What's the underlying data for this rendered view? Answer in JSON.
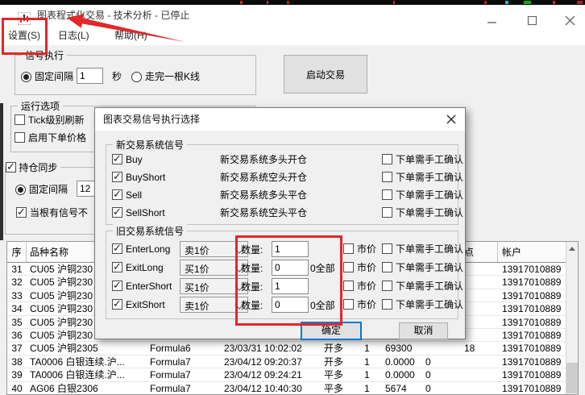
{
  "colors": {
    "annotation_red": "#e0282a",
    "focus_blue": "#0078d7",
    "window_bg": "#f0f0f0",
    "titlebar_bg": "#ffffff"
  },
  "window": {
    "title": "图表程式化交易 - 技术分析 - 已停止",
    "menu": [
      {
        "label": "设置(S)"
      },
      {
        "label": "日志(L)"
      },
      {
        "label": "帮助(H)"
      }
    ]
  },
  "main": {
    "signal_exec": {
      "title": "信号执行",
      "fixed_interval": "固定间隔",
      "interval_value": "1",
      "seconds": "秒",
      "bar_option": "走完一根K线",
      "start_button": "启动交易"
    },
    "run_options": {
      "title": "运行选项",
      "tick": "Tick级别刷新",
      "price": "启用下单价格"
    },
    "pos_sync": {
      "title": "持仓同步",
      "fixed_interval": "固定间隔",
      "interval_value": "12",
      "signal_option": "当根有信号不"
    }
  },
  "dialog": {
    "title": "图表交易信号执行选择",
    "new_group": {
      "title": "新交易系统信号",
      "rows": [
        {
          "name": "Buy",
          "desc": "新交易系统多头开仓",
          "confirm": "下单需手工确认",
          "checked": true,
          "confirm_checked": false
        },
        {
          "name": "BuyShort",
          "desc": "新交易系统空头开仓",
          "confirm": "下单需手工确认",
          "checked": true,
          "confirm_checked": false
        },
        {
          "name": "Sell",
          "desc": "新交易系统多头平仓",
          "confirm": "下单需手工确认",
          "checked": true,
          "confirm_checked": false
        },
        {
          "name": "SellShort",
          "desc": "新交易系统空头平仓",
          "confirm": "下单需手工确认",
          "checked": true,
          "confirm_checked": false
        }
      ]
    },
    "old_group": {
      "title": "旧交易系统信号",
      "qty_label": "数量:",
      "rows": [
        {
          "name": "EnterLong",
          "price_type": "卖1价",
          "qty": "1",
          "all": "",
          "market": "市价",
          "confirm": "下单需手工确认",
          "checked": true,
          "market_checked": false,
          "confirm_checked": false
        },
        {
          "name": "ExitLong",
          "price_type": "买1价",
          "qty": "0",
          "all": "0全部",
          "market": "市价",
          "confirm": "下单需手工确认",
          "checked": true,
          "market_checked": false,
          "confirm_checked": false
        },
        {
          "name": "EnterShort",
          "price_type": "买1价",
          "qty": "1",
          "all": "",
          "market": "市价",
          "confirm": "下单需手工确认",
          "checked": true,
          "market_checked": false,
          "confirm_checked": false
        },
        {
          "name": "ExitShort",
          "price_type": "卖1价",
          "qty": "0",
          "all": "0全部",
          "market": "市价",
          "confirm": "下单需手工确认",
          "checked": true,
          "market_checked": false,
          "confirm_checked": false
        }
      ]
    },
    "ok": "确定",
    "cancel": "取消"
  },
  "table": {
    "headers": {
      "seq": "序",
      "name": "品种名称",
      "formula": "",
      "time": "",
      "dir": "",
      "qty": "",
      "price": "",
      "extra": "",
      "slip": "点",
      "acct": "帐户"
    },
    "rows": [
      {
        "seq": "31",
        "name": "CU05 沪铜230",
        "formula": "",
        "time": "",
        "dir": "",
        "qty": "",
        "price": "",
        "extra": "",
        "slip": "",
        "acct": "13917010889"
      },
      {
        "seq": "32",
        "name": "CU05 沪铜230",
        "formula": "",
        "time": "",
        "dir": "",
        "qty": "",
        "price": "",
        "extra": "",
        "slip": "",
        "acct": "13917010889"
      },
      {
        "seq": "33",
        "name": "CU05 沪铜230",
        "formula": "",
        "time": "",
        "dir": "",
        "qty": "",
        "price": "",
        "extra": "",
        "slip": "",
        "acct": "13917010889"
      },
      {
        "seq": "34",
        "name": "CU05 沪铜230",
        "formula": "",
        "time": "",
        "dir": "",
        "qty": "",
        "price": "",
        "extra": "",
        "slip": "",
        "acct": "13917010889"
      },
      {
        "seq": "35",
        "name": "CU05 沪铜230",
        "formula": "",
        "time": "",
        "dir": "",
        "qty": "",
        "price": "",
        "extra": "",
        "slip": "",
        "acct": "13917010889"
      },
      {
        "seq": "36",
        "name": "CU05 沪铜230",
        "formula": "",
        "time": "",
        "dir": "",
        "qty": "",
        "price": "",
        "extra": "",
        "slip": "",
        "acct": "13917010889"
      },
      {
        "seq": "37",
        "name": "CU05 沪铜2305",
        "formula": "Formula6",
        "time": "23/03/31 10:02:02",
        "dir": "开多",
        "qty": "1",
        "price": "69300",
        "extra": "",
        "slip": "18",
        "acct": "13917010889"
      },
      {
        "seq": "38",
        "name": "TA0006 白银连续.沪...",
        "formula": "Formula7",
        "time": "23/04/12 09:20:37",
        "dir": "开多",
        "qty": "1",
        "price": "0.0000",
        "extra": "0",
        "slip": "",
        "acct": "13917010889"
      },
      {
        "seq": "39",
        "name": "TA0006 白银连续.沪...",
        "formula": "Formula7",
        "time": "23/04/12 09:24:21",
        "dir": "平多",
        "qty": "1",
        "price": "0.0000",
        "extra": "0",
        "slip": "",
        "acct": "13917010889"
      },
      {
        "seq": "40",
        "name": "AG06 白银2306",
        "formula": "Formula7",
        "time": "23/04/12 10:40:30",
        "dir": "平多",
        "qty": "1",
        "price": "5674",
        "extra": "0",
        "slip": "",
        "acct": "13917010889"
      }
    ]
  }
}
